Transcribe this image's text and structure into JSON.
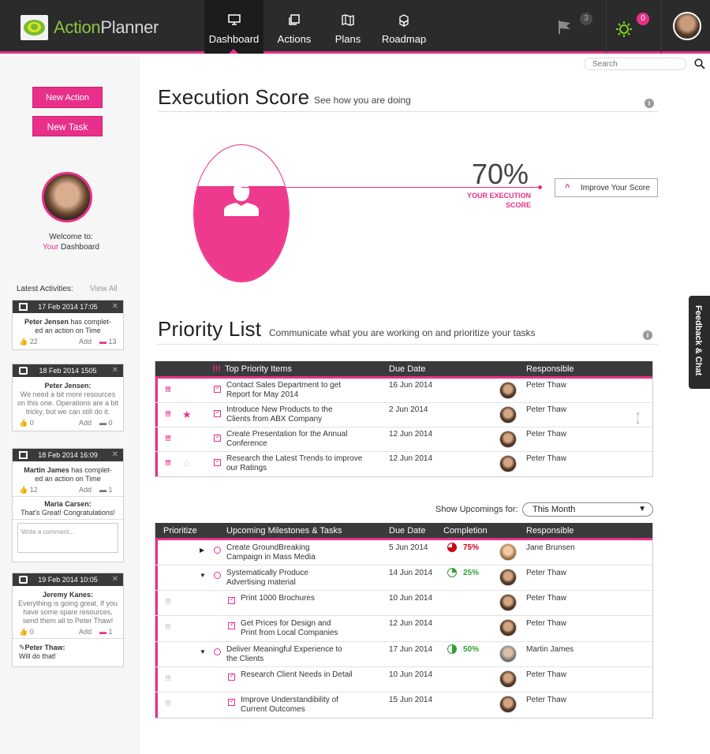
{
  "header": {
    "app_name_part1": "Action",
    "app_name_part2": "Planner",
    "nav": [
      {
        "label": "Dashboard",
        "active": true
      },
      {
        "label": "Actions"
      },
      {
        "label": "Plans"
      },
      {
        "label": "Roadmap"
      }
    ],
    "flag_count": "3",
    "notification_count": "0"
  },
  "search": {
    "placeholder": "Search"
  },
  "sidebar": {
    "new_action_label": "New Action",
    "new_task_label": "New Task",
    "welcome_line1": "Welcome to:",
    "welcome_your": "Your",
    "welcome_dashboard": "Dashboard",
    "latest_label": "Latest Activities:",
    "view_all": "View All",
    "activities": [
      {
        "date": "17 Feb 2014  17:05",
        "name": "Peter Jensen",
        "text1": " has complet-",
        "text2": "ed an action on Time",
        "likes": "22",
        "add": "Add",
        "comments": "13"
      },
      {
        "date": "18 Feb 2014  1505",
        "name": "Peter Jensen:",
        "text1": "We need a bit more resources",
        "text2": "on this one. Operations are a bit",
        "text3": "tricky, but we can still do it.",
        "likes": "0",
        "add": "Add",
        "comments": "0"
      },
      {
        "date": "18 Feb 2014 16:09",
        "name": "Martin James",
        "text1": " has complet-",
        "text2": "ed an action on Time",
        "likes": "12",
        "add": "Add",
        "comments": "1",
        "reply_name": "Maria Carsen:",
        "reply_text": "That's Great! Congratulations!",
        "comment_placeholder": "Write a comment..."
      },
      {
        "date": "19 Feb 2014 10:05",
        "name": "Jeremy Kanes:",
        "text1": "Everything is going great. If you",
        "text2": "have some spare resources,",
        "text3": "send them all to Peter Thaw!",
        "likes": "0",
        "add": "Add",
        "comments": "1",
        "reply_name": "Peter Thaw:",
        "reply_text": "Will do that!"
      }
    ]
  },
  "execution": {
    "title": "Execution Score",
    "subtitle": "See how you are doing",
    "score": "70%",
    "score_fraction": 0.7,
    "score_label1": "YOUR EXECUTION",
    "score_label2": "SCORE",
    "improve_label": "Improve Your Score"
  },
  "priority": {
    "title": "Priority List",
    "subtitle": "Communicate what you are working on and prioritize your tasks",
    "headers": {
      "items": "Top Priority Items",
      "due": "Due Date",
      "resp": "Responsible",
      "marks": "!!!"
    },
    "rows": [
      {
        "mark": "!!!",
        "star": "",
        "task1": "Contact Sales Department to get",
        "task2": "Report for May 2014",
        "due": "16 Jun 2014",
        "who": "Peter Thaw"
      },
      {
        "mark": "!!!",
        "star": "★",
        "task1": "Introduce New Products to the",
        "task2": "Clients from ABX Company",
        "due": "2 Jun 2014",
        "who": "Peter Thaw"
      },
      {
        "mark": "!!!",
        "star": "",
        "task1": "Create Presentation for the Annual",
        "task2": "Conference",
        "due": "12 Jun 2014",
        "who": "Peter Thaw"
      },
      {
        "mark": "!!!",
        "star": "☆",
        "task1": "Research the Latest Trends to improve",
        "task2": "our Ratings",
        "due": "12 Jun 2014",
        "who": "Peter Thaw"
      }
    ]
  },
  "upcoming": {
    "show_label": "Show Upcomings for:",
    "selected": "This Month",
    "headers": {
      "prioritize": "Prioritize",
      "items": "Upcoming Milestones & Tasks",
      "due": "Due Date",
      "completion": "Completion",
      "resp": "Responsible"
    },
    "rows": [
      {
        "level": 0,
        "tri": "▶",
        "kind": "milestone",
        "task1": "Create GroundBreaking",
        "task2": "Campaign in Mass Media",
        "due": "5 Jun 2014",
        "pct": "75%",
        "pct_value": 0.75,
        "pct_color": "#d0021b",
        "who": "Jane Brunsen",
        "av": "f",
        "mark": ""
      },
      {
        "level": 0,
        "tri": "▼",
        "kind": "milestone",
        "task1": "Systematically Produce",
        "task2": "Advertising material",
        "due": "14 Jun 2014",
        "pct": "25%",
        "pct_value": 0.25,
        "pct_color": "#2fa02f",
        "who": "Peter Thaw",
        "av": "",
        "mark": ""
      },
      {
        "level": 1,
        "tri": "",
        "kind": "task",
        "task1": "Print 1000 Brochures",
        "task2": "",
        "due": "10 Jun 2014",
        "pct": "",
        "who": "Peter Thaw",
        "av": "",
        "mark": "!!!"
      },
      {
        "level": 1,
        "tri": "",
        "kind": "task",
        "task1": "Get Prices for Design and",
        "task2": "Print from Local Companies",
        "due": "12 Jun 2014",
        "pct": "",
        "who": "Peter Thaw",
        "av": "",
        "mark": "!!!"
      },
      {
        "level": 0,
        "tri": "▼",
        "kind": "milestone",
        "task1": "Deliver Meaningful Experience to",
        "task2": "the Clients",
        "due": "17 Jun 2014",
        "pct": "50%",
        "pct_value": 0.5,
        "pct_color": "#2fa02f",
        "who": "Martin James",
        "av": "g",
        "mark": ""
      },
      {
        "level": 1,
        "tri": "",
        "kind": "task",
        "task1": "Research Client Needs in Detail",
        "task2": "",
        "due": "10 Jun 2014",
        "pct": "",
        "who": "Peter Thaw",
        "av": "",
        "mark": "!!!"
      },
      {
        "level": 1,
        "tri": "",
        "kind": "task",
        "task1": "Improve Understandibility of",
        "task2": "Current Outcomes",
        "due": "15 Jun 2014",
        "pct": "",
        "who": "Peter Thaw",
        "av": "",
        "mark": "!!!"
      }
    ]
  },
  "feedback_label": "Feedback & Chat",
  "colors": {
    "accent": "#e8308a",
    "header_bg": "#2b2b2b",
    "brand_green": "#8dc63f"
  }
}
